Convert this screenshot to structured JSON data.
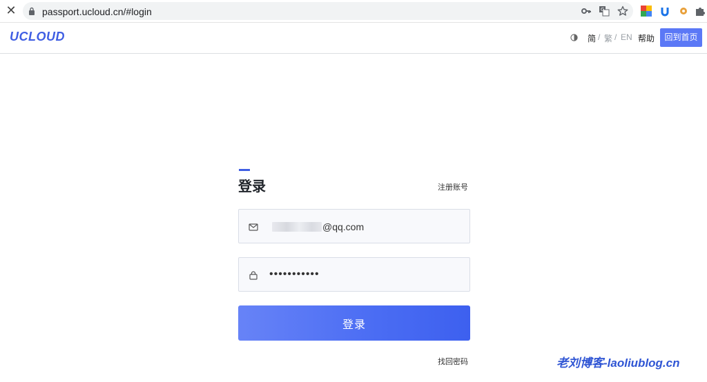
{
  "browser": {
    "url": "passport.ucloud.cn/#login"
  },
  "header": {
    "logo": "UCLOUD",
    "lang_simplified": "简",
    "lang_sep1": "/",
    "lang_traditional": "繁",
    "lang_sep2": "/",
    "lang_english": "EN",
    "help": "帮助",
    "home_button": "回到首页"
  },
  "login": {
    "title": "登录",
    "register_link": "注册账号",
    "email_suffix": "@qq.com",
    "password_masked": "•••••••••••",
    "submit_label": "登录",
    "forgot_link": "找回密码"
  },
  "watermark": "老刘博客-laoliublog.cn",
  "colors": {
    "accent": "#3f5ee3",
    "button": "#4a6cf3"
  }
}
